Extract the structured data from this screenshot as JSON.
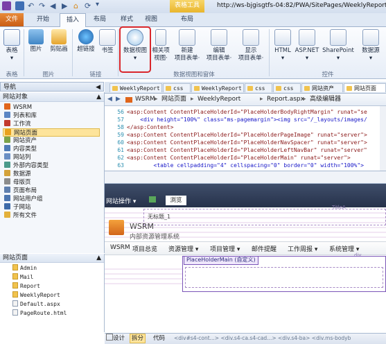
{
  "window": {
    "context_tab": "表格工具",
    "url": "http://ws-bjgisgtfs-04:82/PWA/SitePages/WeeklyReport"
  },
  "tabs": {
    "file": "文件",
    "start": "开始",
    "insert": "插入",
    "layout": "布局",
    "style": "样式",
    "view": "视图",
    "ctx_layout": "布局"
  },
  "ribbon": {
    "table": "表格",
    "picture": "图片",
    "clipart": "剪贴画",
    "hyperlink": "超链接",
    "bookmark": "书签",
    "dataview": "数据视图",
    "related1": "相关项",
    "related2": "视图·",
    "newform1": "新建",
    "newform2": "项目表单·",
    "editform1": "编辑",
    "editform2": "项目表单·",
    "showform1": "显示",
    "showform2": "项目表单·",
    "html": "HTML",
    "aspnet": "ASP.NET",
    "sharepoint": "SharePoint",
    "datasource": "数据源",
    "g_tables": "表格",
    "g_pictures": "图片",
    "g_links": "链接",
    "g_dataview": "数据视图和窗体",
    "g_controls": "控件"
  },
  "nav": {
    "header": "导航",
    "site_objects": "网站对象",
    "items": [
      "WSRM",
      "列表和库",
      "工作流",
      "网站页面",
      "网站资产",
      "内容类型",
      "网站列",
      "外部内容类型",
      "数据源",
      "母版页",
      "页面布局",
      "网站用户组",
      "子网站",
      "所有文件"
    ],
    "site_pages": "网站页面",
    "files": [
      "Admin",
      "Mail",
      "Report",
      "WeeklyReport",
      "Default.aspx",
      "PageRoute.html"
    ]
  },
  "doc_tabs": [
    "WeeklyReport",
    "css",
    "WeeklyReport",
    "css",
    "css",
    "网站资产",
    "网站页面"
  ],
  "breadcrumb": {
    "wsrm": "WSRM",
    "pages": "网站页面",
    "weekly": "WeeklyReport",
    "file": "Report.aspx",
    "editor": "高级编辑器"
  },
  "code_lines": [
    {
      "n": "56",
      "a": "<asp:Content ContentPlaceHolderId=\"PlaceHolderBodyRightMargin\" runat=\"se"
    },
    {
      "n": "57",
      "a": "    <div height=\"100%\" class=\"ms-pagemargin\"><img src=\"/_layouts/images/"
    },
    {
      "n": "58",
      "a": "</asp:Content>"
    },
    {
      "n": "59",
      "a": "<asp:Content ContentPlaceHolderId=\"PlaceHolderPageImage\" runat=\"server\">"
    },
    {
      "n": "60",
      "a": "<asp:Content ContentPlaceHolderId=\"PlaceHolderNavSpacer\" runat=\"server\">"
    },
    {
      "n": "61",
      "a": "<asp:Content ContentPlaceHolderId=\"PlaceHolderLeftNavBar\" runat=\"server\""
    },
    {
      "n": "62",
      "a": "<asp:Content ContentPlaceHolderId=\"PlaceHolderMain\" runat=\"server\">"
    },
    {
      "n": "63",
      "a": "        <table cellpadding=\"4\" cellspacing=\"0\" border=\"0\" width=\"100%\">"
    }
  ],
  "design": {
    "site_actions": "网站操作",
    "browse": "浏览",
    "untitled": "无标题_1",
    "site_title": "WSRM",
    "site_sub": "内部资源管理系统",
    "menu": [
      "WSRM",
      "项目总览",
      "资源管理",
      "项目管理",
      "邮件提醒",
      "工作周报",
      "系统管理"
    ],
    "placeholder": "PlaceHolderMain (自定义)",
    "tag_right": "TitleA",
    "tag2": "div"
  },
  "status": {
    "design": "设计",
    "split": "拆分",
    "code": "代码",
    "path": "<div#s4-cont...> <div.s4-ca.s4-cad...> <div.s4-ba> <div.ms-bodyb"
  }
}
